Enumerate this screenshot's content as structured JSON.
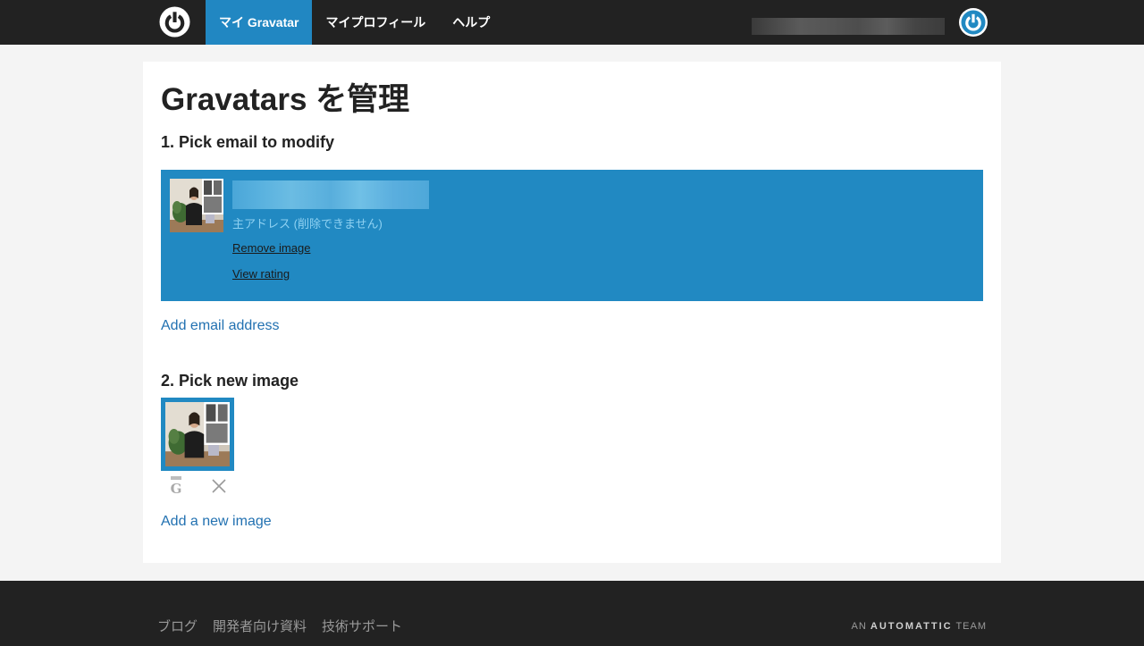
{
  "nav": {
    "items": [
      {
        "label": "マイ Gravatar",
        "active": true
      },
      {
        "label": "マイプロフィール",
        "active": false
      },
      {
        "label": "ヘルプ",
        "active": false
      }
    ]
  },
  "main": {
    "title": "Gravatars を管理",
    "step1": {
      "title": "1. Pick email to modify",
      "email": {
        "primary_label": "主アドレス (削除できません)",
        "remove_image": "Remove image",
        "view_rating": "View rating"
      },
      "add_email": "Add email address"
    },
    "step2": {
      "title": "2. Pick new image",
      "add_image": "Add a new image"
    }
  },
  "footer": {
    "links": [
      "ブログ",
      "開発者向け資料",
      "技術サポート"
    ],
    "brand": {
      "prefix": "AN",
      "name": "AUTOMATTIC",
      "suffix": "TEAM"
    }
  },
  "colors": {
    "topbar": "#222222",
    "accent": "#2189c2",
    "link": "#2271b1",
    "footer": "#222222"
  },
  "icons": {
    "logo": "gravatar-power-icon",
    "avatar": "gravatar-avatar-icon",
    "rating": "rating-g-icon",
    "delete": "close-icon"
  }
}
